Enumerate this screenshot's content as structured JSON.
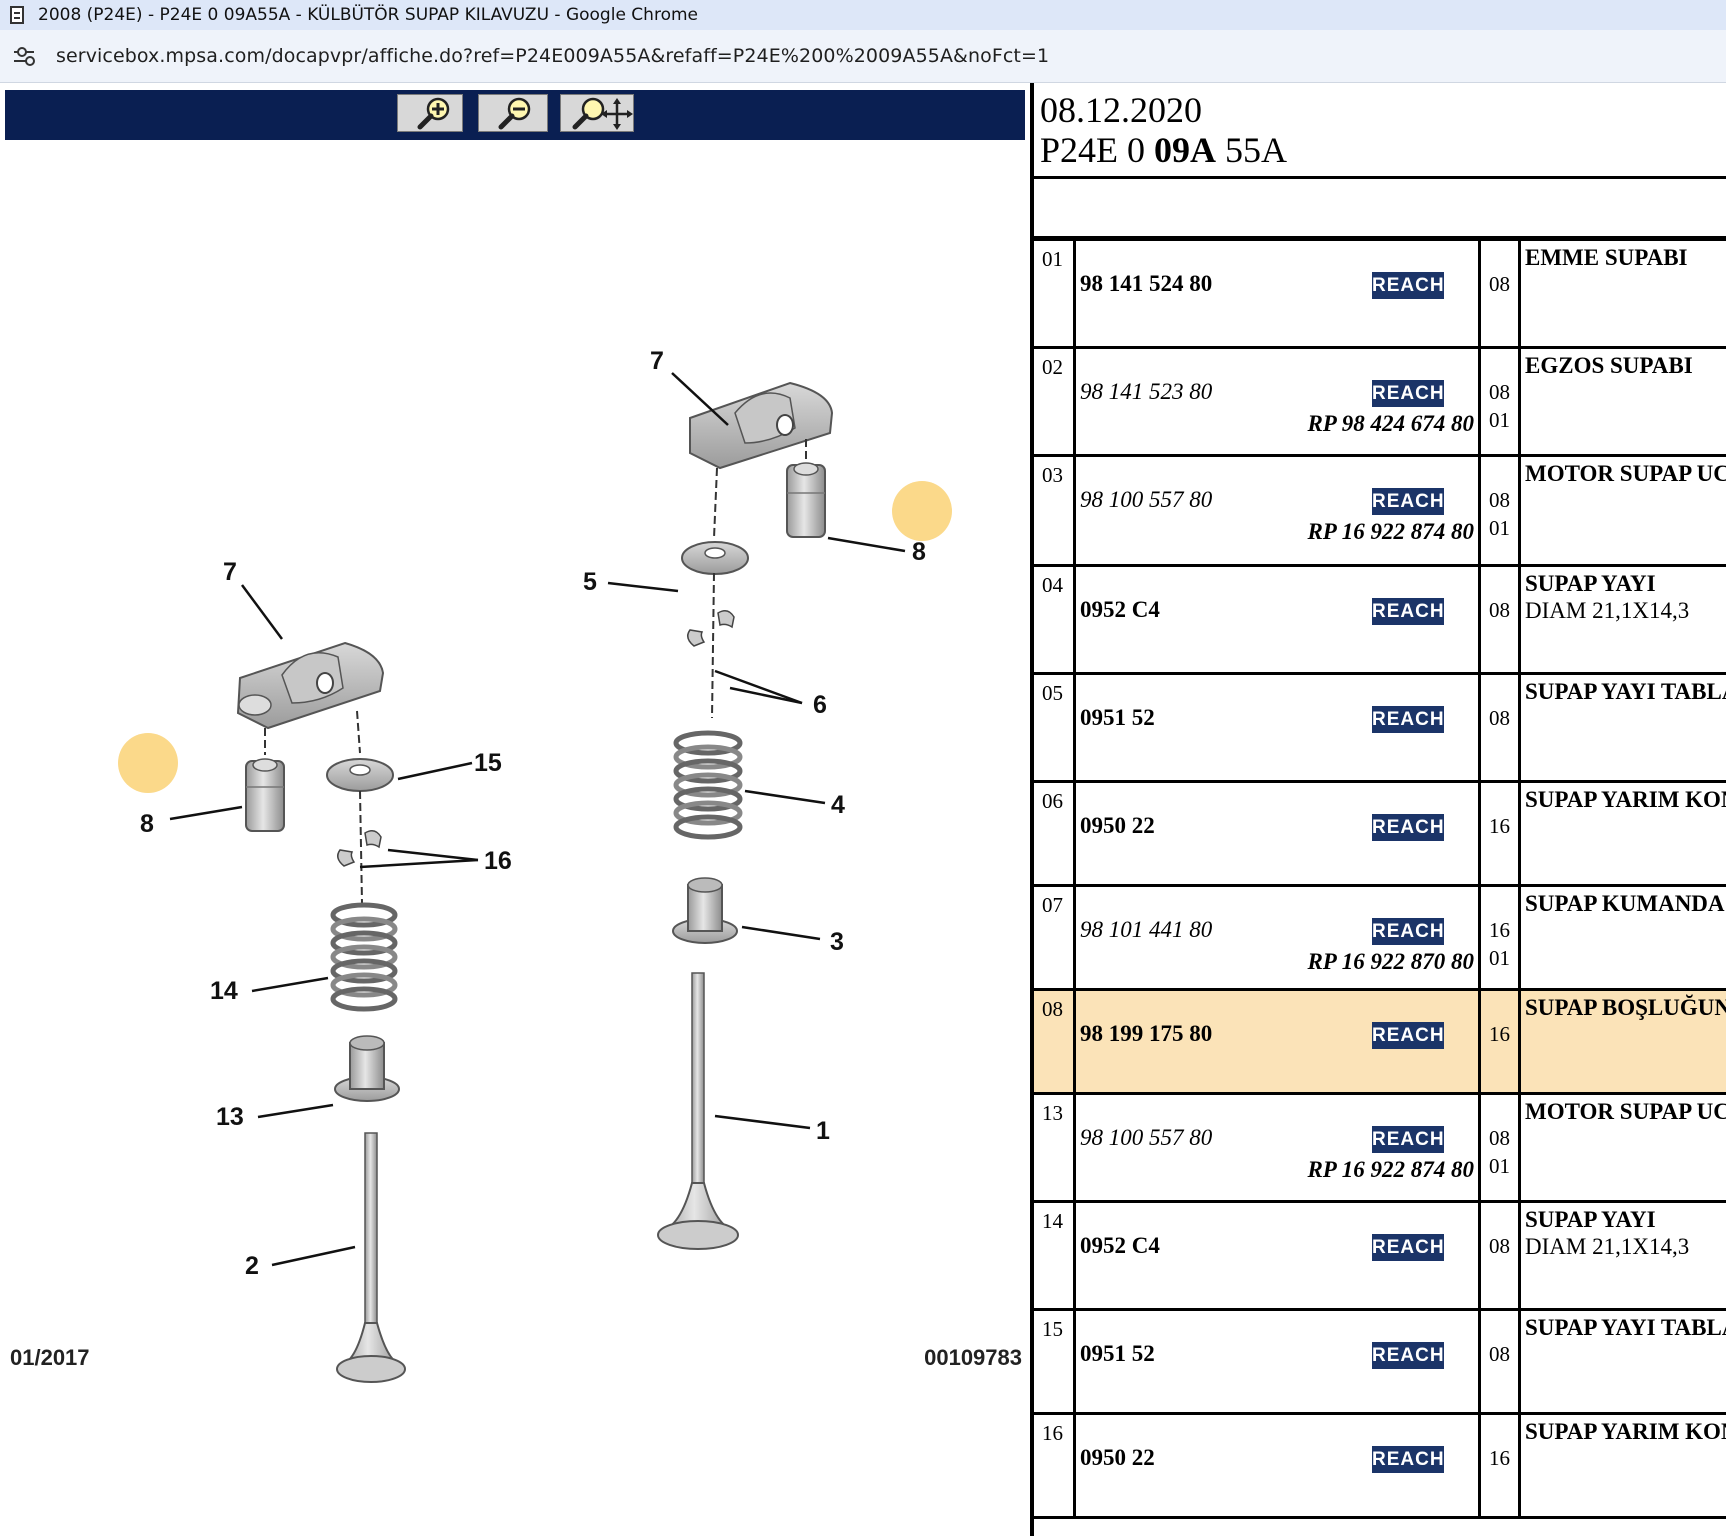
{
  "window": {
    "title": "2008 (P24E) - P24E 0 09A55A - KÜLBÜTÖR SUPAP KILAVUZU - Google Chrome",
    "url": "servicebox.mpsa.com/docapvpr/affiche.do?ref=P24E009A55A&refaff=P24E%200%2009A55A&noFct=1"
  },
  "toolbar": {
    "buttons": [
      "zoom-in",
      "zoom-out",
      "zoom-pan"
    ],
    "icon_color": "#f2c200"
  },
  "diagram": {
    "labels": {
      "l1": "1",
      "l2": "2",
      "l3": "3",
      "l4": "4",
      "l5": "5",
      "l6": "6",
      "l7a": "7",
      "l7b": "7",
      "l8a": "8",
      "l8b": "8",
      "l13": "13",
      "l14": "14",
      "l15": "15",
      "l16": "16"
    },
    "highlight_color": "#fbd98a",
    "date": "01/2017",
    "reference": "00109783"
  },
  "header": {
    "date": "08.12.2020",
    "ref_prefix": "P24E 0 ",
    "ref_bold": "09A",
    "ref_suffix": " 55A"
  },
  "parts": [
    {
      "no": "01",
      "ref": "98 141 524 80",
      "ref_style": "bold",
      "badge": "REACH",
      "qty": "08",
      "qty2": "",
      "rp": "",
      "desc": "EMME SUPABI",
      "desc2": ""
    },
    {
      "no": "02",
      "ref": "98 141 523 80",
      "ref_style": "italic",
      "badge": "REACH",
      "qty": "08",
      "qty2": "01",
      "rp": "RP 98 424 674 80",
      "desc": "EGZOS SUPABI",
      "desc2": ""
    },
    {
      "no": "03",
      "ref": "98 100 557 80",
      "ref_style": "italic",
      "badge": "REACH",
      "qty": "08",
      "qty2": "01",
      "rp": "RP 16 922 874 80",
      "desc": "MOTOR SUPAP UCU",
      "desc2": ""
    },
    {
      "no": "04",
      "ref": "0952 C4",
      "ref_style": "bold",
      "badge": "REACH",
      "qty": "08",
      "qty2": "",
      "rp": "",
      "desc": "SUPAP YAYI",
      "desc2": "DIAM 21,1X14,3"
    },
    {
      "no": "05",
      "ref": "0951 52",
      "ref_style": "bold",
      "badge": "REACH",
      "qty": "08",
      "qty2": "",
      "rp": "",
      "desc": "SUPAP YAYI TABLAS",
      "desc2": ""
    },
    {
      "no": "06",
      "ref": "0950 22",
      "ref_style": "bold",
      "badge": "REACH",
      "qty": "16",
      "qty2": "",
      "rp": "",
      "desc": "SUPAP YARIM KONİ",
      "desc2": ""
    },
    {
      "no": "07",
      "ref": "98 101 441 80",
      "ref_style": "italic",
      "badge": "REACH",
      "qty": "16",
      "qty2": "01",
      "rp": "RP 16 922 870 80",
      "desc": "SUPAP KUMANDA K",
      "desc2": ""
    },
    {
      "no": "08",
      "ref": "98 199 175 80",
      "ref_style": "bold",
      "badge": "REACH",
      "qty": "16",
      "qty2": "",
      "rp": "",
      "desc": "SUPAP BOŞLUĞUNU",
      "desc2": "",
      "selected": true
    },
    {
      "no": "13",
      "ref": "98 100 557 80",
      "ref_style": "italic",
      "badge": "REACH",
      "qty": "08",
      "qty2": "01",
      "rp": "RP 16 922 874 80",
      "desc": "MOTOR SUPAP UCU",
      "desc2": ""
    },
    {
      "no": "14",
      "ref": "0952 C4",
      "ref_style": "bold",
      "badge": "REACH",
      "qty": "08",
      "qty2": "",
      "rp": "",
      "desc": "SUPAP YAYI",
      "desc2": "DIAM 21,1X14,3"
    },
    {
      "no": "15",
      "ref": "0951 52",
      "ref_style": "bold",
      "badge": "REACH",
      "qty": "08",
      "qty2": "",
      "rp": "",
      "desc": "SUPAP YAYI TABLAS",
      "desc2": ""
    },
    {
      "no": "16",
      "ref": "0950 22",
      "ref_style": "bold",
      "badge": "REACH",
      "qty": "16",
      "qty2": "",
      "rp": "",
      "desc": "SUPAP YARIM KONİ",
      "desc2": ""
    }
  ],
  "colors": {
    "toolbar_bg": "#0a1f52",
    "reach_badge": "#1b3468",
    "selected_row": "#fbe3b8"
  }
}
